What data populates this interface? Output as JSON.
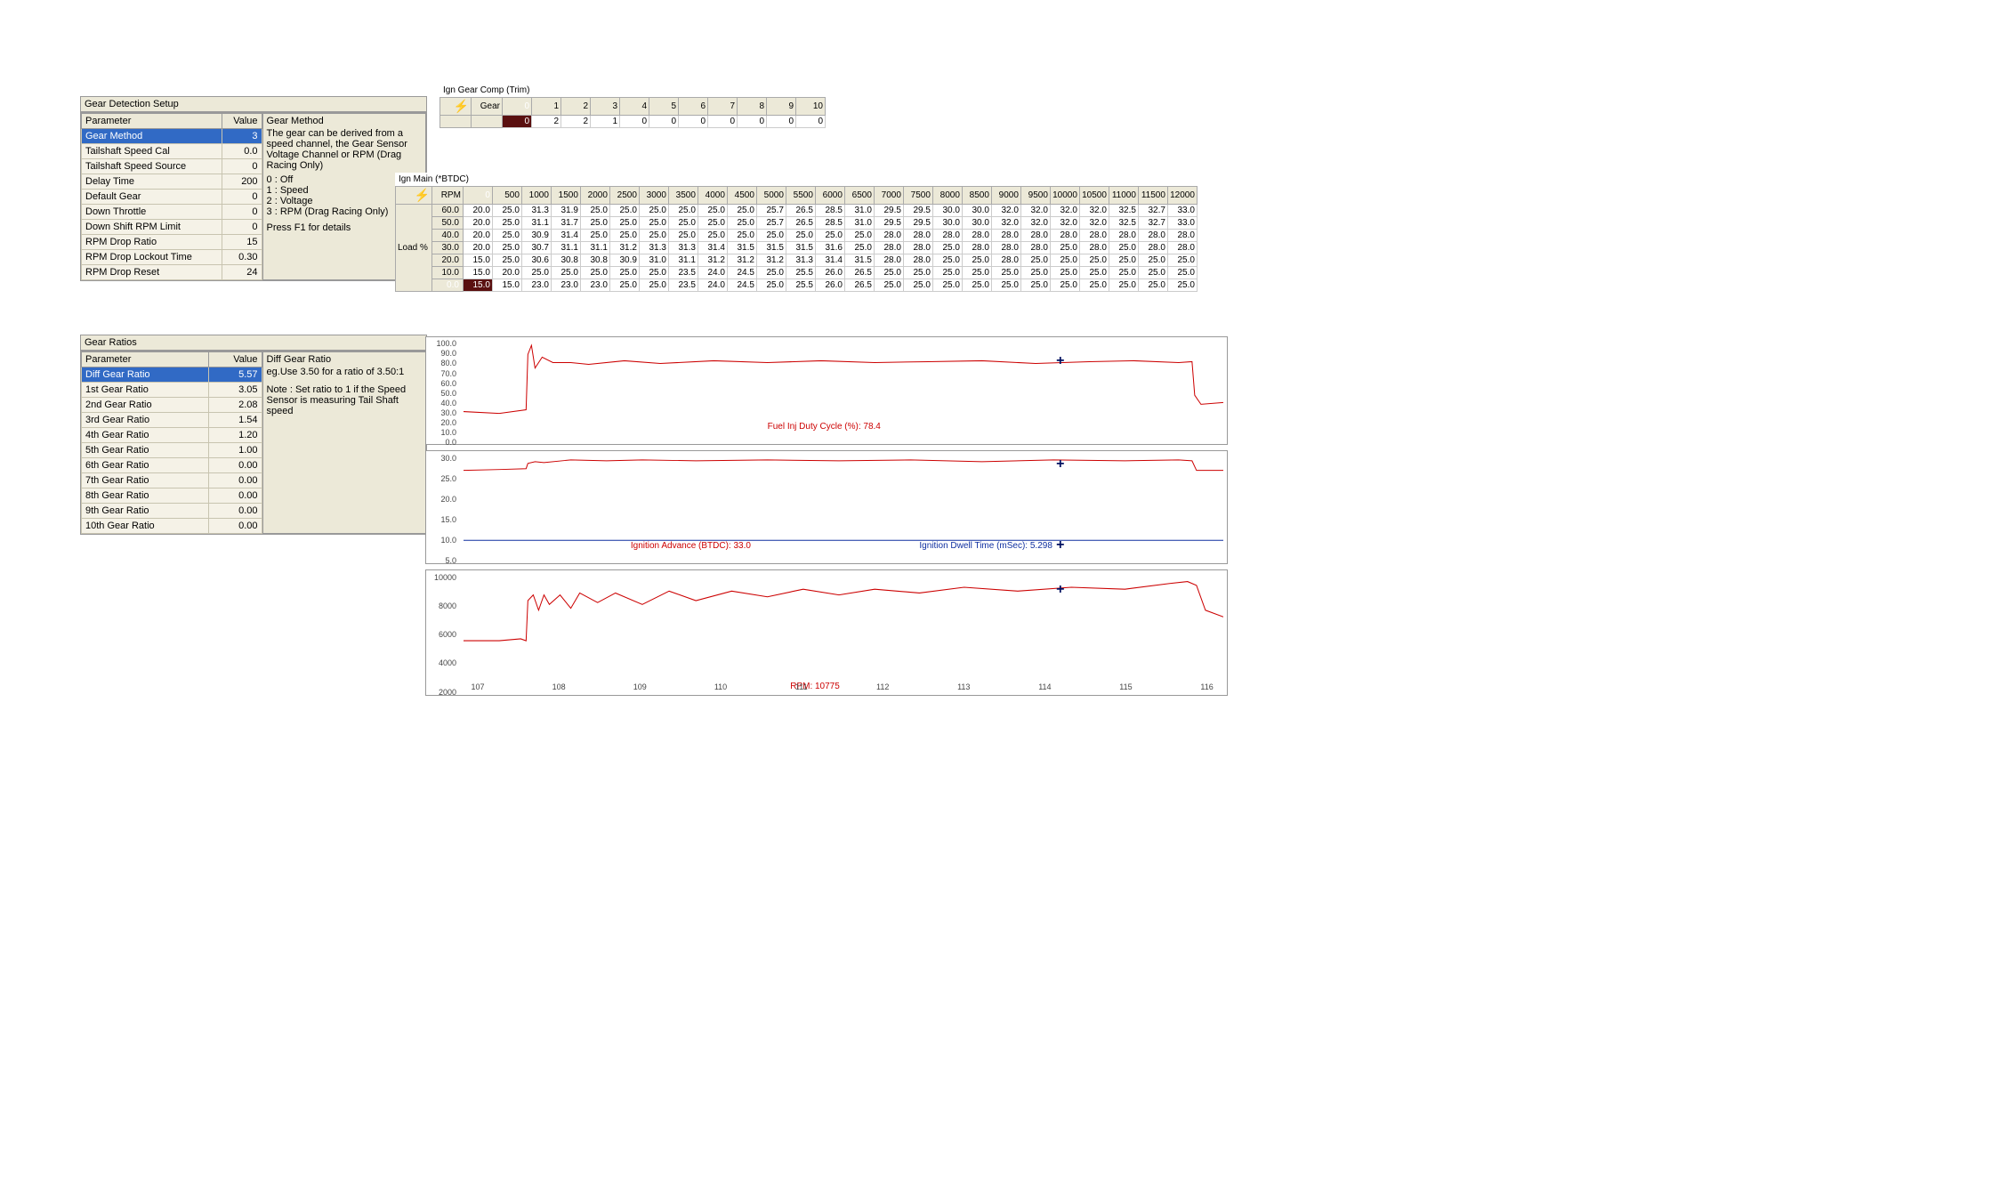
{
  "gear_det": {
    "title": "Gear Detection Setup",
    "cols": [
      "Parameter",
      "Value"
    ],
    "rows": [
      {
        "name": "Gear Method",
        "val": "3"
      },
      {
        "name": "Tailshaft Speed Cal",
        "val": "0.0"
      },
      {
        "name": "Tailshaft Speed Source",
        "val": "0"
      },
      {
        "name": "Delay Time",
        "val": "200"
      },
      {
        "name": "Default Gear",
        "val": "0"
      },
      {
        "name": "Down Throttle",
        "val": "0"
      },
      {
        "name": "Down Shift RPM Limit",
        "val": "0"
      },
      {
        "name": "RPM Drop Ratio",
        "val": "15"
      },
      {
        "name": "RPM Drop Lockout Time",
        "val": "0.30"
      },
      {
        "name": "RPM Drop Reset",
        "val": "24"
      }
    ],
    "desc_title": "Gear Method",
    "desc_body": "The gear can be derived from a speed channel, the Gear Sensor Voltage Channel or RPM (Drag Racing Only)",
    "desc_opts": [
      "0 : Off",
      "1 : Speed",
      "2 : Voltage",
      "3 : RPM (Drag Racing Only)"
    ],
    "desc_foot": "Press F1 for details"
  },
  "gear_ratio": {
    "title": "Gear Ratios",
    "cols": [
      "Parameter",
      "Value"
    ],
    "rows": [
      {
        "name": "Diff Gear Ratio",
        "val": "5.57"
      },
      {
        "name": "1st Gear Ratio",
        "val": "3.05"
      },
      {
        "name": "2nd Gear Ratio",
        "val": "2.08"
      },
      {
        "name": "3rd Gear Ratio",
        "val": "1.54"
      },
      {
        "name": "4th Gear Ratio",
        "val": "1.20"
      },
      {
        "name": "5th Gear Ratio",
        "val": "1.00"
      },
      {
        "name": "6th Gear Ratio",
        "val": "0.00"
      },
      {
        "name": "7th Gear Ratio",
        "val": "0.00"
      },
      {
        "name": "8th Gear Ratio",
        "val": "0.00"
      },
      {
        "name": "9th Gear Ratio",
        "val": "0.00"
      },
      {
        "name": "10th Gear Ratio",
        "val": "0.00"
      }
    ],
    "desc_title": "Diff Gear Ratio",
    "desc_body": "eg.Use 3.50 for a ratio of 3.50:1",
    "desc_note": "Note : Set ratio to 1 if the Speed Sensor is measuring Tail Shaft speed"
  },
  "ign_gear": {
    "title": "Ign Gear Comp (Trim)",
    "row_label": "Gear",
    "headers": [
      "0",
      "1",
      "2",
      "3",
      "4",
      "5",
      "6",
      "7",
      "8",
      "9",
      "10"
    ],
    "values": [
      "0",
      "2",
      "2",
      "1",
      "0",
      "0",
      "0",
      "0",
      "0",
      "0",
      "0"
    ]
  },
  "ign_main": {
    "title": "Ign Main (*BTDC)",
    "col_label": "RPM",
    "row_label": "Load %",
    "rpms": [
      "0",
      "500",
      "1000",
      "1500",
      "2000",
      "2500",
      "3000",
      "3500",
      "4000",
      "4500",
      "5000",
      "5500",
      "6000",
      "6500",
      "7000",
      "7500",
      "8000",
      "8500",
      "9000",
      "9500",
      "10000",
      "10500",
      "11000",
      "11500",
      "12000"
    ],
    "rows": [
      {
        "l": "60.0",
        "v": [
          "20.0",
          "25.0",
          "31.3",
          "31.9",
          "25.0",
          "25.0",
          "25.0",
          "25.0",
          "25.0",
          "25.0",
          "25.7",
          "26.5",
          "28.5",
          "31.0",
          "29.5",
          "29.5",
          "30.0",
          "30.0",
          "32.0",
          "32.0",
          "32.0",
          "32.0",
          "32.5",
          "32.7",
          "33.0"
        ]
      },
      {
        "l": "50.0",
        "v": [
          "20.0",
          "25.0",
          "31.1",
          "31.7",
          "25.0",
          "25.0",
          "25.0",
          "25.0",
          "25.0",
          "25.0",
          "25.7",
          "26.5",
          "28.5",
          "31.0",
          "29.5",
          "29.5",
          "30.0",
          "30.0",
          "32.0",
          "32.0",
          "32.0",
          "32.0",
          "32.5",
          "32.7",
          "33.0"
        ]
      },
      {
        "l": "40.0",
        "v": [
          "20.0",
          "25.0",
          "30.9",
          "31.4",
          "25.0",
          "25.0",
          "25.0",
          "25.0",
          "25.0",
          "25.0",
          "25.0",
          "25.0",
          "25.0",
          "25.0",
          "28.0",
          "28.0",
          "28.0",
          "28.0",
          "28.0",
          "28.0",
          "28.0",
          "28.0",
          "28.0",
          "28.0",
          "28.0"
        ]
      },
      {
        "l": "30.0",
        "v": [
          "20.0",
          "25.0",
          "30.7",
          "31.1",
          "31.1",
          "31.2",
          "31.3",
          "31.3",
          "31.4",
          "31.5",
          "31.5",
          "31.5",
          "31.6",
          "25.0",
          "28.0",
          "28.0",
          "25.0",
          "28.0",
          "28.0",
          "28.0",
          "25.0",
          "28.0",
          "25.0",
          "28.0",
          "28.0"
        ]
      },
      {
        "l": "20.0",
        "v": [
          "15.0",
          "25.0",
          "30.6",
          "30.8",
          "30.8",
          "30.9",
          "31.0",
          "31.1",
          "31.2",
          "31.2",
          "31.2",
          "31.3",
          "31.4",
          "31.5",
          "28.0",
          "28.0",
          "25.0",
          "25.0",
          "28.0",
          "25.0",
          "25.0",
          "25.0",
          "25.0",
          "25.0",
          "25.0"
        ]
      },
      {
        "l": "10.0",
        "v": [
          "15.0",
          "20.0",
          "25.0",
          "25.0",
          "25.0",
          "25.0",
          "25.0",
          "23.5",
          "24.0",
          "24.5",
          "25.0",
          "25.5",
          "26.0",
          "26.5",
          "25.0",
          "25.0",
          "25.0",
          "25.0",
          "25.0",
          "25.0",
          "25.0",
          "25.0",
          "25.0",
          "25.0",
          "25.0"
        ]
      },
      {
        "l": "0.0",
        "v": [
          "15.0",
          "15.0",
          "23.0",
          "23.0",
          "23.0",
          "25.0",
          "25.0",
          "23.5",
          "24.0",
          "24.5",
          "25.0",
          "25.5",
          "26.0",
          "26.5",
          "25.0",
          "25.0",
          "25.0",
          "25.0",
          "25.0",
          "25.0",
          "25.0",
          "25.0",
          "25.0",
          "25.0",
          "25.0"
        ]
      }
    ]
  },
  "charts": {
    "c1": {
      "label": "Fuel Inj Duty Cycle (%): 78.4",
      "color": "#c00",
      "yticks": [
        "100.0",
        "90.0",
        "80.0",
        "70.0",
        "60.0",
        "50.0",
        "40.0",
        "30.0",
        "20.0",
        "10.0",
        "0.0"
      ]
    },
    "c2": {
      "label1": "Ignition Advance (BTDC): 33.0",
      "label2": "Ignition Dwell Time (mSec): 5.298",
      "yticks": [
        "30.0",
        "25.0",
        "20.0",
        "15.0",
        "10.0",
        "5.0"
      ]
    },
    "c3": {
      "label": "RPM: 10775",
      "yticks": [
        "10000",
        "8000",
        "6000",
        "4000",
        "2000"
      ],
      "xticks": [
        "107",
        "108",
        "109",
        "110",
        "111",
        "112",
        "113",
        "114",
        "115",
        "116"
      ]
    }
  }
}
